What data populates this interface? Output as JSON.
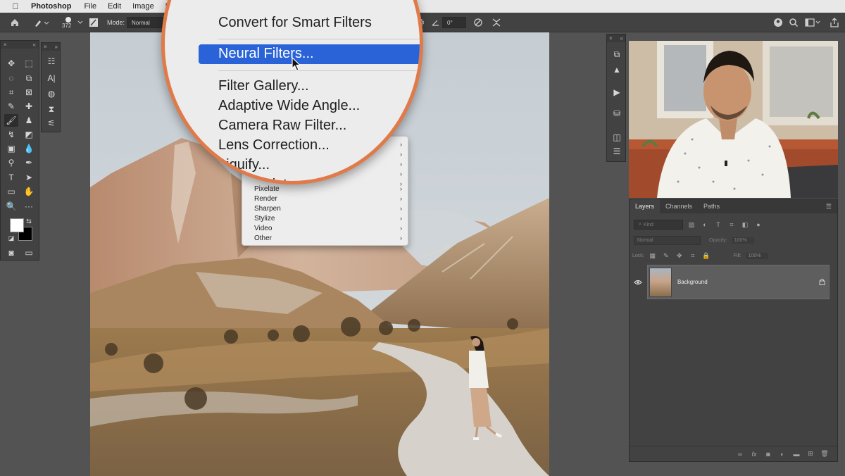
{
  "menubar": {
    "app_name": "Photoshop",
    "items": [
      "File",
      "Edit",
      "Image",
      "La"
    ]
  },
  "options_bar": {
    "brush_size": "372",
    "mode_label": "Mode:",
    "mode_value": "Normal",
    "angle_value": "0°"
  },
  "magnifier_menu": {
    "convert_label": "Convert for Smart Filters",
    "neural_label": "Neural Filters...",
    "filter_gallery_label": "Filter Gallery...",
    "adaptive_label": "Adaptive Wide Angle...",
    "camera_raw_label": "Camera Raw Filter...",
    "lens_label": "Lens Correction...",
    "liquify_label": "Liquify...",
    "vanishing_partial": "…ing Point…"
  },
  "filter_menu": {
    "items": [
      {
        "label": "Pixelate",
        "has_submenu": true
      },
      {
        "label": "Render",
        "has_submenu": true
      },
      {
        "label": "Sharpen",
        "has_submenu": true
      },
      {
        "label": "Stylize",
        "has_submenu": true
      },
      {
        "label": "Video",
        "has_submenu": true
      },
      {
        "label": "Other",
        "has_submenu": true
      }
    ],
    "arrow_glyph": "›"
  },
  "layers_panel": {
    "tabs": [
      "Layers",
      "Channels",
      "Paths"
    ],
    "active_tab": "Layers",
    "kind_placeholder": "Kind",
    "blend_mode": "Normal",
    "opacity_label": "Opacity:",
    "opacity_value": "100%",
    "lock_label": "Lock:",
    "fill_label": "Fill:",
    "fill_value": "100%",
    "layer_name": "Background"
  },
  "colors": {
    "accent_highlight": "#2a63d8",
    "magnifier_ring": "#e07a48",
    "panel_bg": "#424242",
    "workspace_bg": "#535353"
  },
  "icons": {
    "apple": "apple-logo-icon",
    "home": "home-icon",
    "brush": "brush-icon",
    "cursor": "pointer-cursor-icon",
    "eye": "eye-icon",
    "lock": "lock-icon"
  }
}
